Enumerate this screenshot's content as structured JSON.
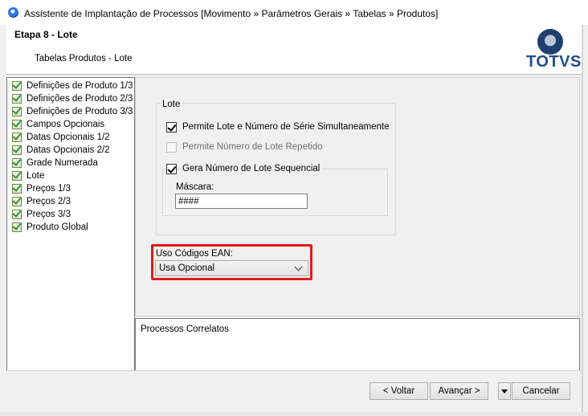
{
  "window": {
    "title": "Assistente de Implantação de Processos [Movimento » Parâmetros Gerais » Tabelas » Produtos]"
  },
  "header": {
    "step_title": "Etapa 8 - Lote",
    "subtitle": "Tabelas Produtos - Lote",
    "logo_text": "TOTVS"
  },
  "nav": {
    "items": [
      {
        "label": "Definições de Produto 1/3"
      },
      {
        "label": "Definições de Produto 2/3"
      },
      {
        "label": "Definições de Produto 3/3"
      },
      {
        "label": "Campos Opcionais"
      },
      {
        "label": "Datas Opcionais 1/2"
      },
      {
        "label": "Datas Opcionais 2/2"
      },
      {
        "label": "Grade Numerada"
      },
      {
        "label": "Lote"
      },
      {
        "label": "Preços 1/3"
      },
      {
        "label": "Preços 2/3"
      },
      {
        "label": "Preços 3/3"
      },
      {
        "label": "Produto Global"
      }
    ]
  },
  "lote": {
    "group_title": "Lote",
    "opt_simultaneo": {
      "label": "Permite Lote e Número de Série Simultaneamente",
      "checked": true,
      "enabled": true
    },
    "opt_repetido": {
      "label": "Permite Número de Lote Repetido",
      "checked": false,
      "enabled": false
    },
    "opt_sequencial": {
      "label": "Gera Número de Lote Sequencial",
      "checked": true,
      "enabled": true
    },
    "mask_label": "Máscara:",
    "mask_value": "####"
  },
  "ean": {
    "label": "Uso Códigos EAN:",
    "selected": "Usa Opcional",
    "highlight_color": "#e01a1a"
  },
  "related": {
    "title": "Processos Correlatos"
  },
  "buttons": {
    "back": "< Voltar",
    "next": "Avançar >",
    "cancel": "Cancelar"
  }
}
